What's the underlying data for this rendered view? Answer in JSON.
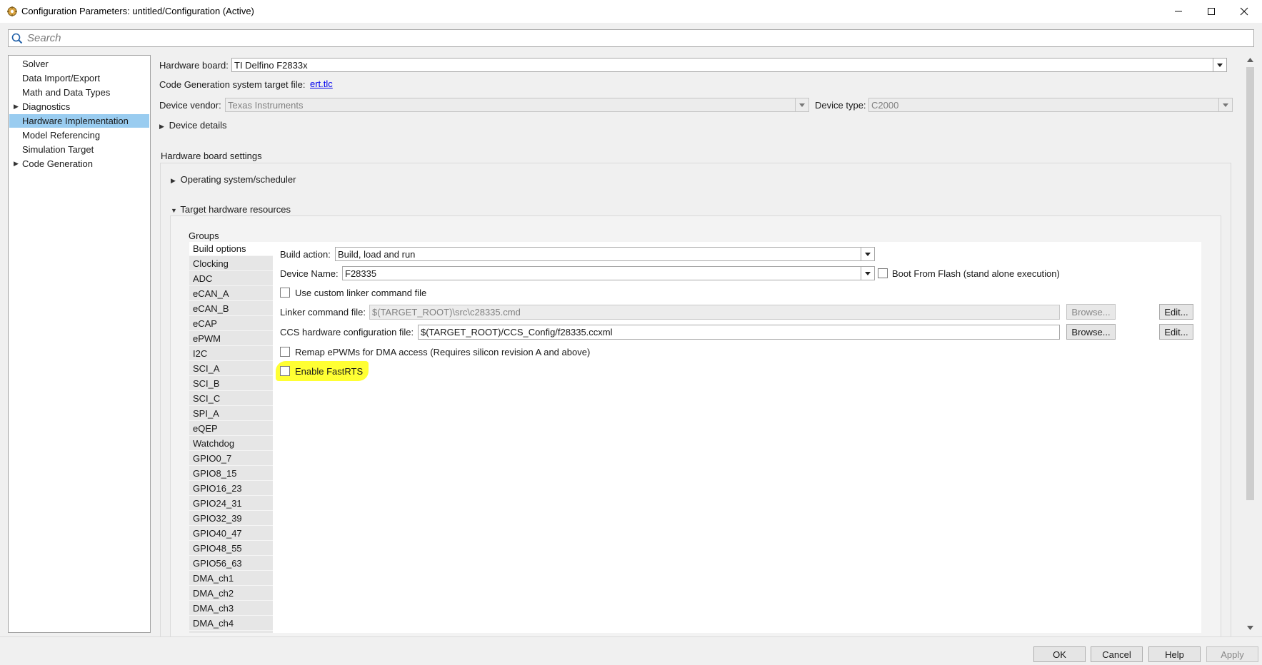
{
  "window": {
    "title": "Configuration Parameters: untitled/Configuration (Active)"
  },
  "search": {
    "placeholder": "Search"
  },
  "tree": {
    "items": [
      {
        "label": "Solver",
        "expandable": false,
        "selected": false
      },
      {
        "label": "Data Import/Export",
        "expandable": false,
        "selected": false
      },
      {
        "label": "Math and Data Types",
        "expandable": false,
        "selected": false
      },
      {
        "label": "Diagnostics",
        "expandable": true,
        "selected": false
      },
      {
        "label": "Hardware Implementation",
        "expandable": false,
        "selected": true
      },
      {
        "label": "Model Referencing",
        "expandable": false,
        "selected": false
      },
      {
        "label": "Simulation Target",
        "expandable": false,
        "selected": false
      },
      {
        "label": "Code Generation",
        "expandable": true,
        "selected": false
      }
    ]
  },
  "hardware": {
    "board_label": "Hardware board:",
    "board_value": "TI Delfino F2833x",
    "codegen_label": "Code Generation system target file:",
    "codegen_link": "ert.tlc",
    "vendor_label": "Device vendor:",
    "vendor_value": "Texas Instruments",
    "type_label": "Device type:",
    "type_value": "C2000",
    "device_details": "Device details",
    "board_settings": "Hardware board settings",
    "os_scheduler": "Operating system/scheduler",
    "target_resources": "Target hardware resources"
  },
  "groups": {
    "title": "Groups",
    "items": [
      "Build options",
      "Clocking",
      "ADC",
      "eCAN_A",
      "eCAN_B",
      "eCAP",
      "ePWM",
      "I2C",
      "SCI_A",
      "SCI_B",
      "SCI_C",
      "SPI_A",
      "eQEP",
      "Watchdog",
      "GPIO0_7",
      "GPIO8_15",
      "GPIO16_23",
      "GPIO24_31",
      "GPIO32_39",
      "GPIO40_47",
      "GPIO48_55",
      "GPIO56_63",
      "DMA_ch1",
      "DMA_ch2",
      "DMA_ch3",
      "DMA_ch4"
    ],
    "selected": "Build options"
  },
  "build": {
    "action_label": "Build action:",
    "action_value": "Build, load and run",
    "device_name_label": "Device Name:",
    "device_name_value": "F28335",
    "boot_flash_label": "Boot From Flash (stand alone execution)",
    "custom_linker_label": "Use custom linker command file",
    "linker_file_label": "Linker command file:",
    "linker_file_value": "$(TARGET_ROOT)\\src\\c28335.cmd",
    "ccs_config_label": "CCS hardware configuration file:",
    "ccs_config_value": "$(TARGET_ROOT)/CCS_Config/f28335.ccxml",
    "browse_label": "Browse...",
    "edit_label": "Edit...",
    "remap_label": "Remap ePWMs for DMA access (Requires silicon revision A and above)",
    "fastrts_label": "Enable FastRTS",
    "highlight_color": "#ffff33"
  },
  "footer": {
    "ok": "OK",
    "cancel": "Cancel",
    "help": "Help",
    "apply": "Apply"
  },
  "colors": {
    "selection": "#99ccf0",
    "link": "#0000ee"
  },
  "icons": [
    "app-icon",
    "minimize-icon",
    "maximize-icon",
    "close-icon",
    "search-icon",
    "chevron-down-icon",
    "expand-arrow-icon"
  ]
}
